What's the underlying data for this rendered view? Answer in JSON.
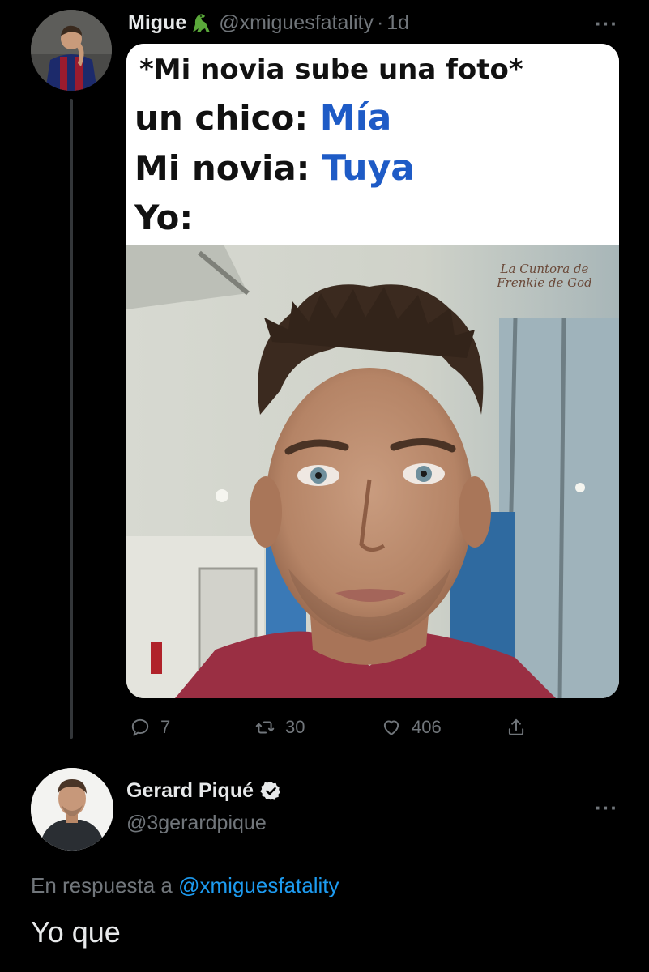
{
  "tweet": {
    "author_name": "Migue",
    "author_emoji_icon": "dinosaur-icon",
    "handle": "@xmiguesfatality",
    "separator": "·",
    "time": "1d",
    "more_label": "···",
    "meme": {
      "line1": "*Mi novia sube una foto*",
      "line2_prefix": "un chico:",
      "line2_value": "Mía",
      "line3_prefix": "Mi novia:",
      "line3_value": "Tuya",
      "line4": "Yo:",
      "watermark_line1": "La Cuntora de",
      "watermark_line2": "Frenkie de God"
    },
    "actions": {
      "reply_count": "7",
      "retweet_count": "30",
      "like_count": "406"
    }
  },
  "reply": {
    "author_name": "Gerard Piqué",
    "verified_icon": "verified-badge-icon",
    "handle": "@3gerardpique",
    "more_label": "···",
    "replying_prefix": "En respuesta a",
    "replying_to": "@xmiguesfatality",
    "text": "Yo que"
  },
  "colors": {
    "background": "#000000",
    "primary_text": "#e7e9ea",
    "secondary_text": "#71767b",
    "link": "#1d9bf0",
    "meme_blue": "#1e5bc6"
  }
}
